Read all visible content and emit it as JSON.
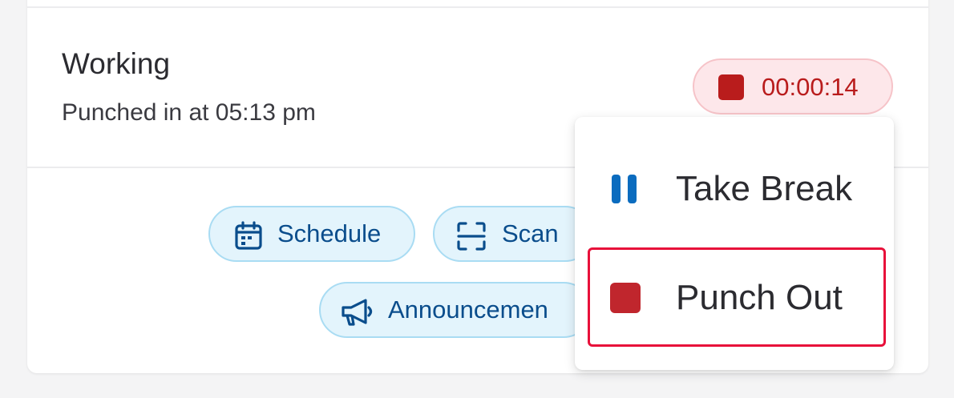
{
  "status": {
    "title": "Working",
    "subtitle": "Punched in at 05:13 pm"
  },
  "timer": {
    "value": "00:00:14",
    "icon": "stop-square-icon",
    "color": "#b91c1c"
  },
  "quick_actions": [
    {
      "label": "Schedule",
      "icon": "calendar-icon"
    },
    {
      "label": "Scan",
      "icon": "scan-icon"
    },
    {
      "label": "Announcemen",
      "icon": "megaphone-icon"
    }
  ],
  "menu": {
    "items": [
      {
        "label": "Take Break",
        "icon": "pause-icon",
        "icon_color": "#0b6cbf"
      },
      {
        "label": "Punch Out",
        "icon": "stop-square-icon",
        "icon_color": "#c0262d"
      }
    ]
  },
  "colors": {
    "accent_blue": "#0a4d8c",
    "chip_bg": "#e3f4fc",
    "danger": "#b91c1c",
    "highlight_border": "#e8103a"
  }
}
